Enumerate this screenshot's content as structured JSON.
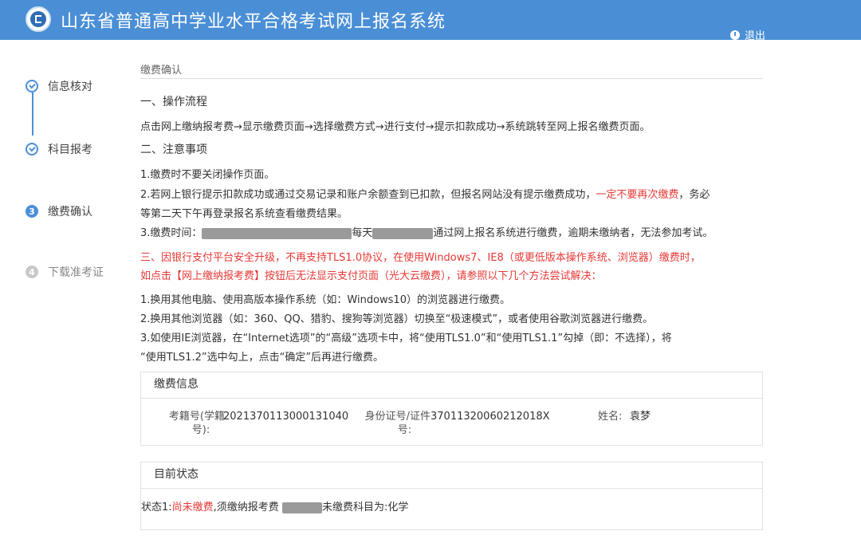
{
  "header": {
    "title": "山东省普通高中学业水平合格考试网上报名系统",
    "logout_label": "退出"
  },
  "steps": [
    {
      "number": "1",
      "label": "信息核对",
      "state": "done"
    },
    {
      "number": "2",
      "label": "科目报考",
      "state": "done"
    },
    {
      "number": "3",
      "label": "缴费确认",
      "state": "active"
    },
    {
      "number": "4",
      "label": "下载准考证",
      "state": "todo"
    }
  ],
  "content": {
    "section_title": "缴费确认",
    "flow_heading": "一、操作流程",
    "flow_text": "点击网上缴纳报考费→显示缴费页面→选择缴费方式→进行支付→提示扣款成功→系统跳转至网上报名缴费页面。",
    "notes_heading": "二、注意事项",
    "note1": "1.缴费时不要关闭操作页面。",
    "note2_a": "2.若网上银行提示扣款成功或通过交易记录和账户余额查到已扣款，但报名网站没有提示缴费成功，",
    "note2_red": "一定不要再次缴费",
    "note2_b": "，务必",
    "note2_c": "等第二天下午再登录报名系统查看缴费结果。",
    "note3_a": "3.缴费时间：",
    "note3_b": "每天",
    "note3_c": "通过网上报名系统进行缴费，逾期未缴纳者，无法参加考试。",
    "warn_line1": "三、因银行支付平台安全升级，不再支持TLS1.0协议，在使用Windows7、IE8（或更低版本操作系统、浏览器）缴费时，",
    "warn_line2": "如点击【网上缴纳报考费】按钮后无法显示支付页面（光大云缴费），请参照以下几个方法尝试解决：",
    "method1": "1.换用其他电脑、使用高版本操作系统（如：Windows10）的浏览器进行缴费。",
    "method2": "2.换用其他浏览器（如：360、QQ、猎豹、搜狗等浏览器）切换至“极速模式”，或者使用谷歌浏览器进行缴费。",
    "method3_a": "3.如使用IE浏览器，在“Internet选项”的“高级”选项卡中，将“使用TLS1.0”和“使用TLS1.1”勾掉（即：不选择），将",
    "method3_b": "“使用TLS1.2”选中勾上，点击“确定”后再进行缴费。"
  },
  "payment_info": {
    "title": "缴费信息",
    "exam_no_label_1": "考籍号(学籍",
    "exam_no_label_2": "号):",
    "exam_no_value": "2021370113000131040",
    "id_label_1": "身份证号/证件",
    "id_label_2": "号:",
    "id_value": "37011320060212018X",
    "name_label": "姓名:",
    "name_value": "袁梦"
  },
  "status": {
    "title": "目前状态",
    "prefix": "状态1:",
    "state_red": "尚未缴费",
    "mid": ",须缴纳报考费",
    "suffix": "未缴费科目为:化学"
  },
  "colors": {
    "header_bg": "#4a8fd6",
    "accent": "#4a8fd6",
    "warning": "#e53935"
  }
}
